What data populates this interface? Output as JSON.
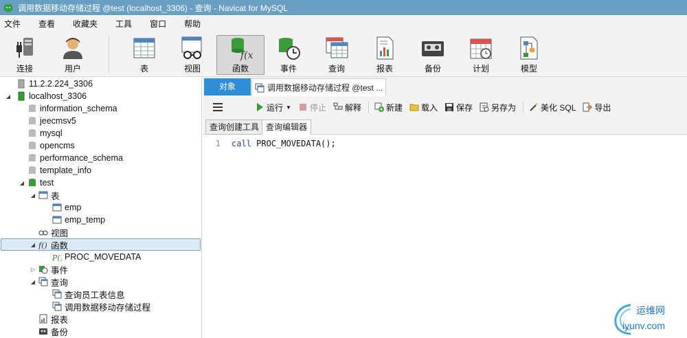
{
  "window": {
    "title": "调用数据移动存储过程 @test (localhost_3306) - 查询 - Navicat for MySQL"
  },
  "menubar": {
    "items": [
      "文件",
      "查看",
      "收藏夹",
      "工具",
      "窗口",
      "帮助"
    ]
  },
  "toolbar": {
    "connect": "连接",
    "user": "用户",
    "table": "表",
    "view": "视图",
    "function": "函数",
    "event": "事件",
    "query": "查询",
    "report": "报表",
    "backup": "备份",
    "schedule": "计划",
    "model": "模型",
    "active": "函数"
  },
  "sidebar": {
    "rows": [
      "11.2.2.224_3306",
      "localhost_3306",
      "information_schema",
      "jeecmsv5",
      "mysql",
      "opencms",
      "performance_schema",
      "template_info",
      "test",
      "表",
      "emp",
      "emp_temp",
      "视图",
      "函数",
      "PROC_MOVEDATA",
      "事件",
      "查询",
      "查询员工表信息",
      "调用数据移动存储过程",
      "报表",
      "备份"
    ]
  },
  "tabs": {
    "objects": "对象",
    "query_tab": "调用数据移动存储过程 @test ..."
  },
  "query_toolbar": {
    "run": "运行",
    "stop": "停止",
    "explain": "解释",
    "new": "新建",
    "load": "载入",
    "save": "保存",
    "save_as": "另存为",
    "beautify": "美化 SQL",
    "export": "导出"
  },
  "subtabs": {
    "builder": "查询创建工具",
    "editor": "查询编辑器"
  },
  "editor": {
    "line_number": "1",
    "keyword": "call",
    "rest": " PROC_MOVEDATA();"
  },
  "watermark": {
    "top": "运维网",
    "bottom": "iyunv.com"
  },
  "colors": {
    "titlebar": "#6a9fc4",
    "accent_tab": "#2f8ed8",
    "selection": "#dde9f7"
  }
}
